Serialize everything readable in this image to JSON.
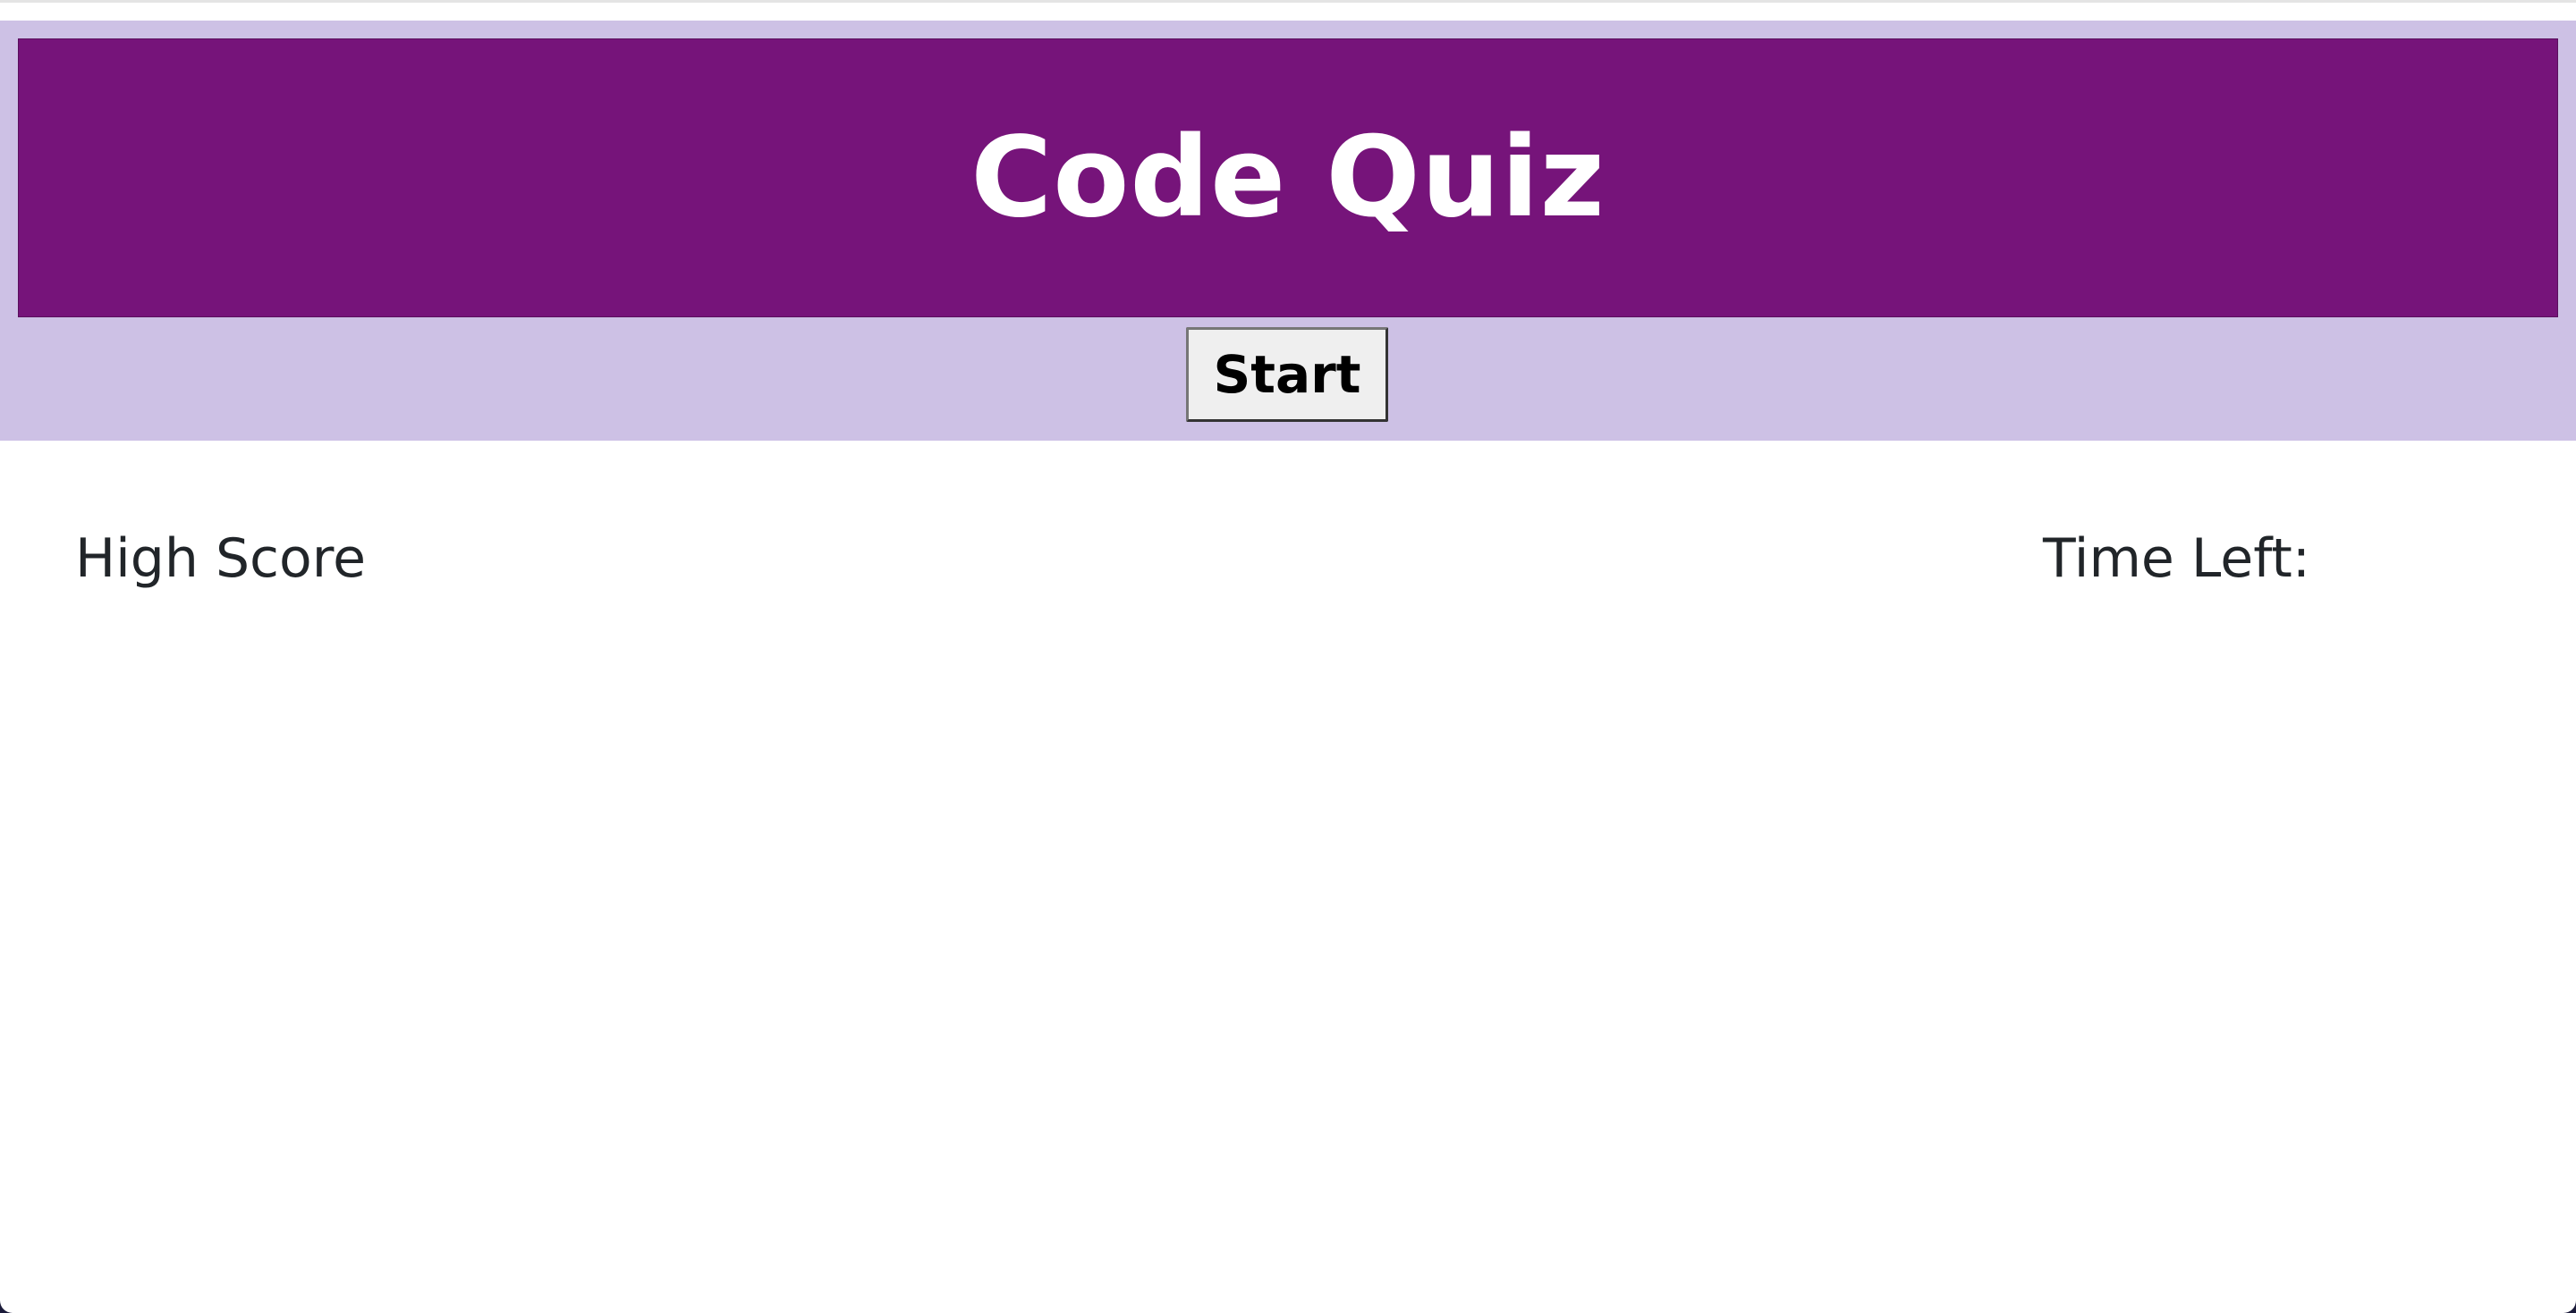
{
  "header": {
    "title": "Code Quiz",
    "title_color": "#ffffff",
    "title_bar_color": "#76147a",
    "band_color": "#cdc1e5"
  },
  "controls": {
    "start_label": "Start"
  },
  "status": {
    "high_score_label": "High Score",
    "time_left_label": "Time Left:"
  }
}
